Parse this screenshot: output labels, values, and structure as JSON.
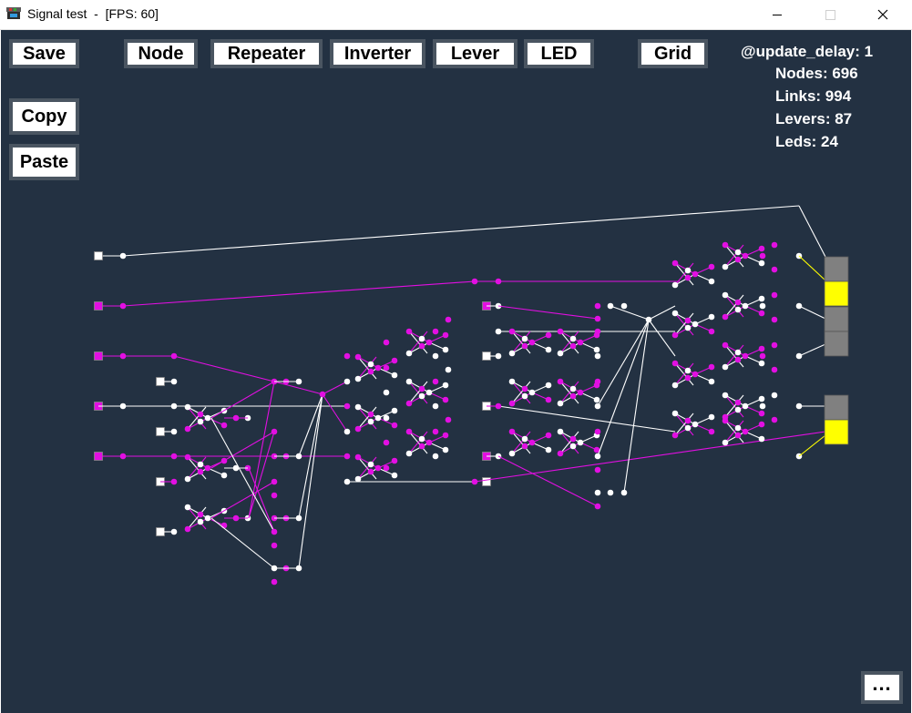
{
  "window": {
    "title": "Signal test  -  [FPS: 60]",
    "icons": {
      "app": "gear-app-icon",
      "minimize": "minimize-icon",
      "maximize": "maximize-icon",
      "close": "close-icon"
    }
  },
  "toolbar": {
    "save": "Save",
    "node": "Node",
    "repeater": "Repeater",
    "inverter": "Inverter",
    "lever": "Lever",
    "led": "LED",
    "grid": "Grid",
    "copy": "Copy",
    "paste": "Paste",
    "more": "..."
  },
  "stats": {
    "update_delay": "@update_delay: 1",
    "nodes": "Nodes: 696",
    "links": "Links: 994",
    "levers": "Levers: 87",
    "leds": "Leds: 24"
  },
  "colors": {
    "background": "#233142",
    "active_signal": "#e20fe2",
    "inactive_signal": "#ffffff",
    "led_on": "#ffff00",
    "led_off": "#808080",
    "button_border": "#4a5561"
  },
  "led_states": [
    "off",
    "on",
    "off",
    "off",
    "off",
    "on"
  ],
  "lever_states": [
    "off",
    "on",
    "on",
    "off",
    "on",
    "off",
    "on",
    "off",
    "off",
    "on",
    "off",
    "off",
    "on",
    "off"
  ]
}
